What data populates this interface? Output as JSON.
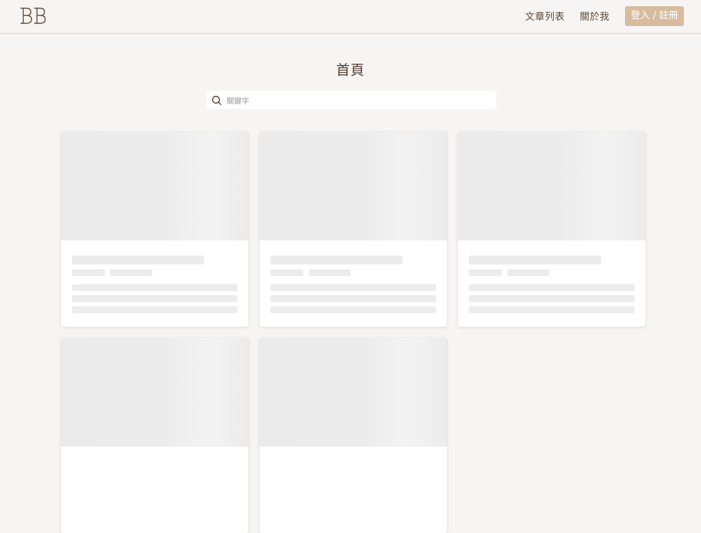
{
  "header": {
    "logo_text": "BB",
    "nav": {
      "articles_label": "文章列表",
      "about_label": "關於我",
      "login_label": "登入 / 註冊"
    }
  },
  "main": {
    "title": "首頁",
    "search": {
      "placeholder": "關鍵字",
      "value": ""
    },
    "cards_state": "loading",
    "visible_card_count": 5
  },
  "colors": {
    "background": "#f7f5f3",
    "accent": "#d7bc9f",
    "text": "#5a4636",
    "skeleton": "#ececec"
  },
  "icons": [
    "logo-icon",
    "search-icon"
  ]
}
